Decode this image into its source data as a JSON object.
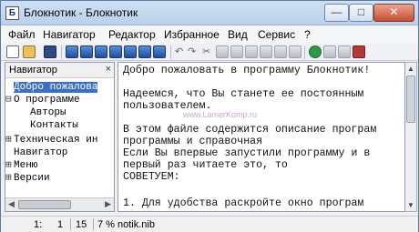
{
  "window": {
    "title": "Блокнотик - Блокнотик",
    "app_icon_glyph": "Б",
    "controls": {
      "minimize": "—",
      "maximize": "□",
      "close": "✕"
    }
  },
  "menu": [
    "Файл",
    "Навигатор",
    "Редактор",
    "Избранное",
    "Вид",
    "Сервис",
    "?"
  ],
  "toolbar_icons": [
    "new-document-icon",
    "open-folder-icon",
    "save-disk-icon",
    "blue-tool-icon",
    "undo-icon",
    "redo-icon",
    "cut-icon",
    "copy-icon",
    "paste-icon",
    "info-icon",
    "checkmark-icon",
    "book-icon"
  ],
  "navigator": {
    "title": "Навигатор",
    "close_glyph": "×",
    "items": [
      {
        "label": "Добро пожалова",
        "expander": "",
        "selected": true
      },
      {
        "label": "О программе",
        "expander": "⊟",
        "selected": false
      },
      {
        "label": "Авторы",
        "expander": "",
        "selected": false
      },
      {
        "label": "Контакты",
        "expander": "",
        "selected": false
      },
      {
        "label": "Техническая ин",
        "expander": "⊞",
        "selected": false
      },
      {
        "label": "Навигатор",
        "expander": "",
        "selected": false
      },
      {
        "label": "Меню",
        "expander": "⊞",
        "selected": false
      },
      {
        "label": "Версии",
        "expander": "⊞",
        "selected": false
      }
    ]
  },
  "editor": {
    "lines": [
      "Добро пожаловать в программу Блокнотик!",
      "",
      "Надеемся, что Вы станете ее постоянным",
      "пользователем.",
      "",
      "В этом файле содержится описание програм",
      "программы и справочная",
      "Если Вы впервые запустили программу и в",
      "первый раз читаете это, то",
      "СОВЕТУЕМ:",
      "",
      "1. Для удобства раскройте окно програм"
    ]
  },
  "watermark": "www.LamerKomp.ru",
  "status": {
    "line": "1:",
    "col": "1",
    "chars": "15",
    "percent": "7 %",
    "file": "notik.nib"
  }
}
